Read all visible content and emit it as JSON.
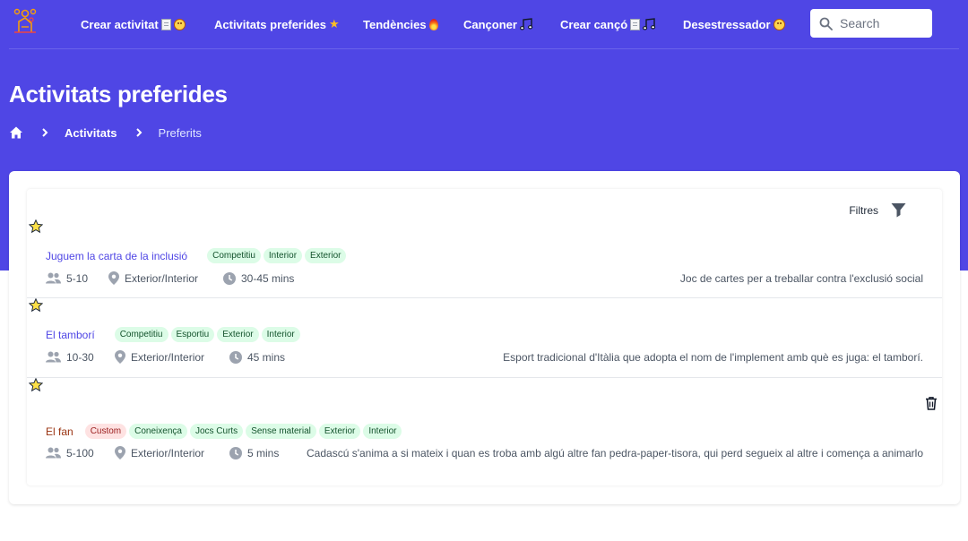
{
  "nav": {
    "items": [
      {
        "label": "Crear activitat",
        "emoji": [
          "note",
          "face"
        ]
      },
      {
        "label": "Activitats preferides",
        "emoji": [
          "star"
        ]
      },
      {
        "label": "Tendències",
        "emoji": [
          "fire"
        ]
      },
      {
        "label": "Cançoner",
        "emoji": [
          "music"
        ]
      },
      {
        "label": "Crear cançó",
        "emoji": [
          "note",
          "music"
        ]
      },
      {
        "label": "Desestressador",
        "emoji": [
          "face"
        ]
      }
    ],
    "search_placeholder": "Search"
  },
  "header": {
    "title": "Activitats preferides",
    "breadcrumb": [
      "Activitats",
      "Preferits"
    ]
  },
  "filters": {
    "label": "Filtres"
  },
  "activities": [
    {
      "title": "Juguem la carta de la inclusió",
      "custom": false,
      "tags": [
        "Competitiu",
        "Interior",
        "Exterior"
      ],
      "participants": "5-10",
      "location": "Exterior/Interior",
      "duration": "30-45 mins",
      "description": "Joc de cartes per a treballar contra l'exclusió social",
      "favorite": true
    },
    {
      "title": "El tamborí",
      "custom": false,
      "tags": [
        "Competitiu",
        "Esportiu",
        "Exterior",
        "Interior"
      ],
      "participants": "10-30",
      "location": "Exterior/Interior",
      "duration": "45 mins",
      "description": "Esport tradicional d'Itàlia que adopta el nom de l'implement amb què es juga: el tamborí.",
      "favorite": true
    },
    {
      "title": "El fan",
      "custom": true,
      "tags": [
        "Custom",
        "Coneixença",
        "Jocs Curts",
        "Sense material",
        "Exterior",
        "Interior"
      ],
      "participants": "5-100",
      "location": "Exterior/Interior",
      "duration": "5 mins",
      "description": "Cadascú s'anima a si mateix i quan es troba amb algú altre fan pedra-paper-tisora, qui perd segueix al altre i comença a animarlo",
      "favorite": true
    }
  ],
  "colors": {
    "primary": "#4f46e5",
    "tag_green_bg": "#dcfce7",
    "tag_red_bg": "#fee2e2",
    "star": "#fde047"
  }
}
